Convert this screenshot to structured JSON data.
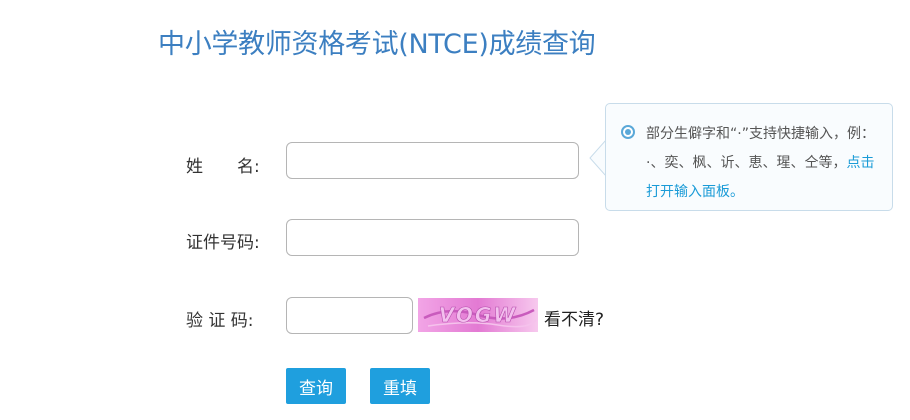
{
  "page": {
    "title": "中小学教师资格考试(NTCE)成绩查询"
  },
  "form": {
    "name_label": "姓　　名:",
    "id_label": "证件号码:",
    "captcha_label": "验 证 码:",
    "name_value": "",
    "id_value": "",
    "captcha_value": "",
    "captcha_image_text": "VOGW",
    "unclear_link": "看不清?",
    "query_button": "查询",
    "reset_button": "重填"
  },
  "tip": {
    "text": "部分生僻字和“·”支持快捷输入，例：·、奕、枫、䜣、恵、瑆、仝等，",
    "link": "点击打开输入面板。"
  },
  "colors": {
    "title": "#3c7fc1",
    "button": "#1f9fde",
    "link": "#1a9bd7",
    "tip_border": "#c8dcea",
    "captcha_bg": "#e97fd5"
  }
}
